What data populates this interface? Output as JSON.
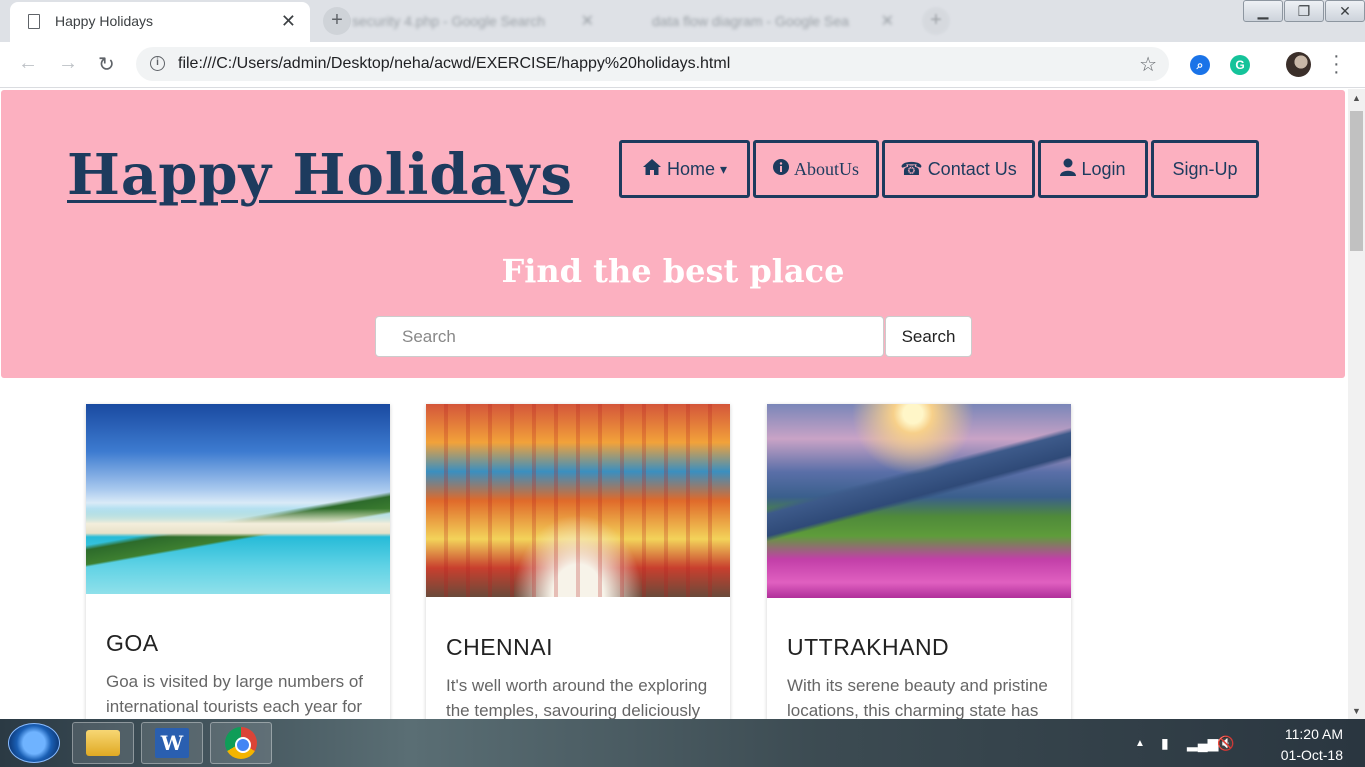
{
  "browser": {
    "active_tab": {
      "title": "Happy Holidays",
      "close": "✕"
    },
    "other_tabs": [
      {
        "title": "security 4.php - Google Search",
        "close": "✕"
      },
      {
        "title": "data flow diagram - Google Sea",
        "close": "✕"
      }
    ],
    "new_tab": "+",
    "window_controls": {
      "minimize": "▁",
      "restore": "❐",
      "close": "✕"
    },
    "url": "file:///C:/Users/admin/Desktop/neha/acwd/EXERCISE/happy%20holidays.html"
  },
  "page": {
    "brand": "Happy Holidays",
    "nav": [
      {
        "label": "Home",
        "icon": "home-icon",
        "caret": "▾"
      },
      {
        "label": "AboutUs",
        "icon": "info-icon"
      },
      {
        "label": "Contact Us",
        "icon": "phone-icon"
      },
      {
        "label": "Login",
        "icon": "user-icon"
      },
      {
        "label": "Sign-Up"
      }
    ],
    "hero_heading": "Find the best place",
    "search": {
      "placeholder": "Search",
      "button": "Search"
    },
    "cards": [
      {
        "title": "GOA",
        "text": "Goa is visited by large numbers of international tourists each year for"
      },
      {
        "title": "CHENNAI",
        "text": "It's well worth around the exploring the temples, savouring deliciously"
      },
      {
        "title": "UTTRAKHAND",
        "text": "With its serene beauty and pristine locations, this charming state has"
      }
    ]
  },
  "taskbar": {
    "apps": [
      "file-explorer",
      "microsoft-word",
      "google-chrome"
    ],
    "time": "11:20 AM",
    "date": "01-Oct-18"
  },
  "colors": {
    "hero_bg": "#fcb0c0",
    "brand_navy": "#1d3b5e",
    "hero_heading": "#ffffff"
  }
}
